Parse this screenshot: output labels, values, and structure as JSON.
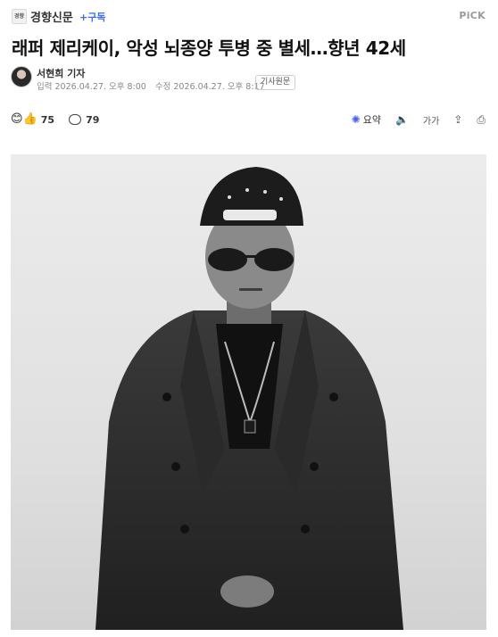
{
  "header": {
    "press_logo_text": "경향",
    "press_name": "경향신문",
    "subscribe_label": "+구독",
    "pick_label": "PiCK"
  },
  "article": {
    "headline": "래퍼 제리케이, 악성 뇌종양 투병 중 별세…향년 42세",
    "reporter": "서현희 기자",
    "published_label": "입력",
    "published": "2026.04.27. 오후 8:00",
    "modified_label": "수정",
    "modified": "2026.04.27. 오후 8:17",
    "original_button": "기사원문"
  },
  "reactions": {
    "reaction_icon": "😊👍",
    "reaction_count": "75",
    "comment_count": "79"
  },
  "tools": {
    "summary_icon": "✺",
    "summary_label": "요약",
    "listen_icon": "🔈",
    "font_label": "가가",
    "share_icon": "⇪",
    "print_icon": "⎙"
  },
  "colors": {
    "accent": "#3d6ef0",
    "summary_accent": "#4a63e8"
  }
}
